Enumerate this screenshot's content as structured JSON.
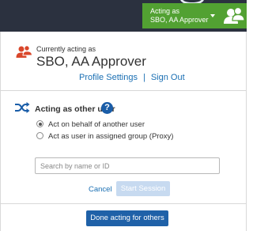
{
  "header": {
    "acting_line1": "Acting as",
    "acting_line2": "SBO, AA Approver"
  },
  "current": {
    "label": "Currently acting as",
    "name": "SBO, AA Approver",
    "profile_link": "Profile Settings",
    "separator": "|",
    "signout_link": "Sign Out"
  },
  "act_other": {
    "title": "Acting as other user",
    "help_glyph": "?",
    "options": [
      {
        "label": "Act on behalf of another user",
        "selected": true
      },
      {
        "label": "Act as user in assigned group (Proxy)",
        "selected": false
      }
    ],
    "search_placeholder": "Search by name or ID",
    "cancel_label": "Cancel",
    "start_label": "Start Session"
  },
  "footer": {
    "done_label": "Done acting for others"
  },
  "colors": {
    "topbar": "#2b313f",
    "green": "#52a132",
    "accent_red": "#d9472b",
    "link": "#1a6fb3",
    "primary": "#1f61a8",
    "disabled": "#c7daf0"
  }
}
